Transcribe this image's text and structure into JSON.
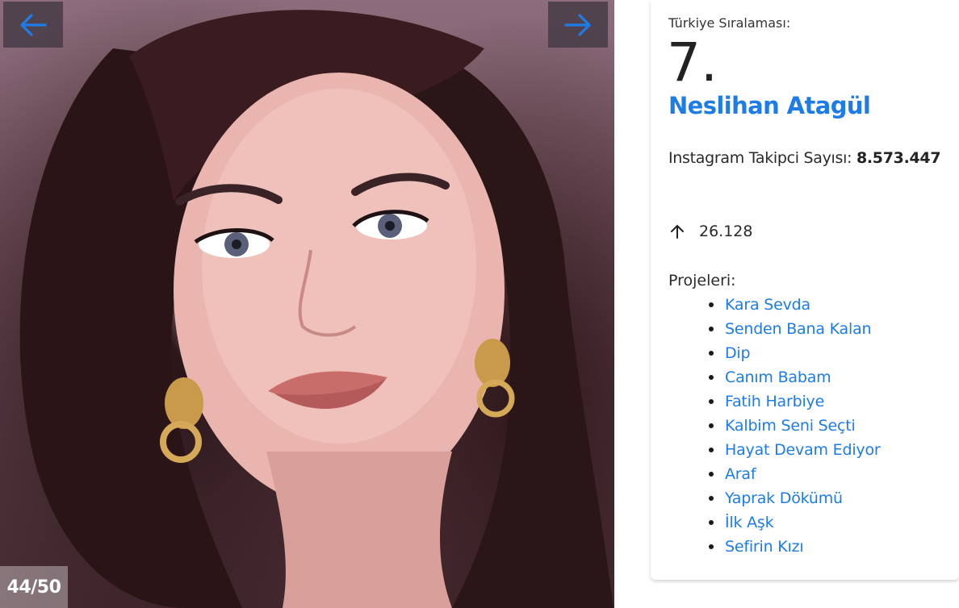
{
  "gallery": {
    "prev_icon": "arrow-left-icon",
    "next_icon": "arrow-right-icon",
    "counter": "44/50",
    "photo_alt": "Neslihan Atagül"
  },
  "profile": {
    "rank_label": "Türkiye Sıralaması:",
    "rank_value": "7.",
    "name": "Neslihan Atagül",
    "followers_label": "Instagram Takipci Sayısı:",
    "followers_value": "8.573.447",
    "change_icon": "arrow-up-icon",
    "change_value": "26.128",
    "projects_label": "Projeleri:",
    "projects": [
      "Kara Sevda",
      "Senden Bana Kalan",
      "Dip",
      "Canım Babam",
      "Fatih Harbiye",
      "Kalbim Seni Seçti",
      "Hayat Devam Ediyor",
      "Araf",
      "Yaprak Dökümü",
      "İlk Aşk",
      "Sefirin Kızı"
    ]
  },
  "colors": {
    "accent": "#1e7ce8",
    "nav_button_bg": "#463c46",
    "text": "#222222"
  }
}
